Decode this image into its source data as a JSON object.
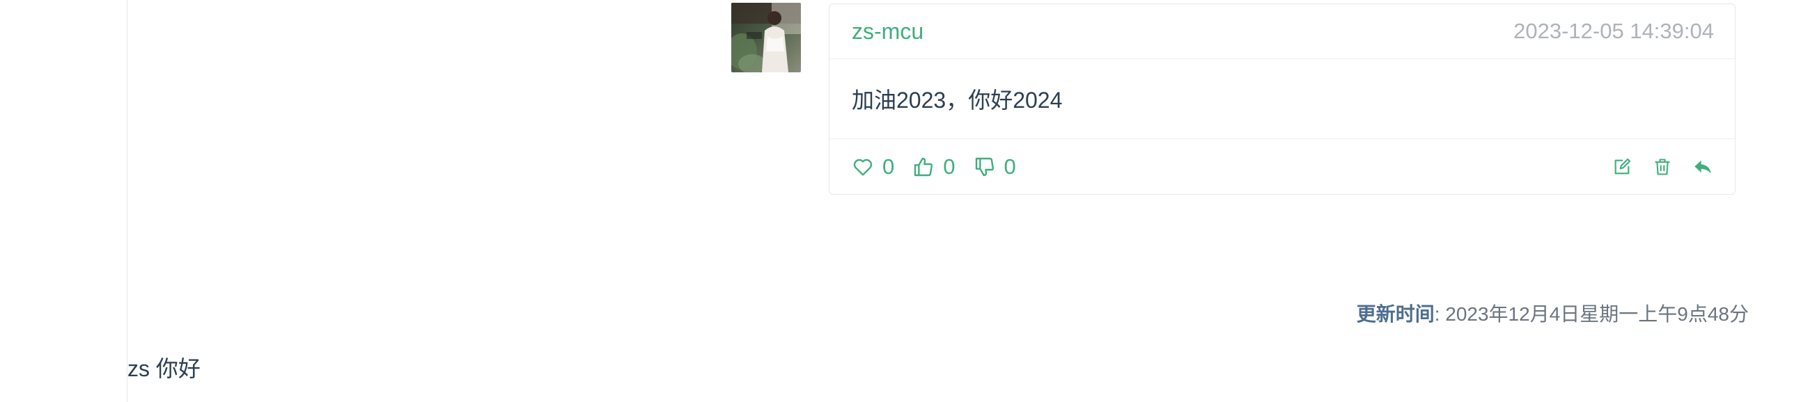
{
  "comment": {
    "username": "zs-mcu",
    "timestamp": "2023-12-05 14:39:04",
    "text": "加油2023，你好2024",
    "reactions": {
      "like": {
        "icon": "heart-icon",
        "count": "0"
      },
      "upvote": {
        "icon": "thumbs-up-icon",
        "count": "0"
      },
      "downvote": {
        "icon": "thumbs-down-icon",
        "count": "0"
      }
    },
    "actions": [
      "edit-icon",
      "delete-icon",
      "reply-icon"
    ]
  },
  "page_meta": {
    "updated_label": "更新时间",
    "updated_sep": ": ",
    "updated_value": "2023年12月4日星期一上午9点48分"
  },
  "content": {
    "text": "zs 你好"
  },
  "colors": {
    "accent": "#3eaf7c",
    "timestamp": "#aeb3b9",
    "text": "#2c3e50"
  }
}
